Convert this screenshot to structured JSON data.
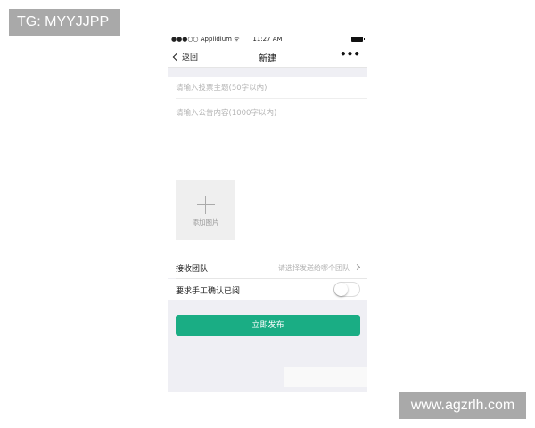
{
  "watermarks": {
    "top_left": "TG: MYYJJPP",
    "bottom_right": "www.agzrlh.com"
  },
  "status_bar": {
    "carrier": "●●●○○ Applidium ᯤ",
    "time": "11:27 AM",
    "battery_icon": "battery-icon"
  },
  "nav": {
    "back_label": "返回",
    "title": "新建",
    "more_label": "•••"
  },
  "form": {
    "title_placeholder": "请输入投票主题(50字以内)",
    "content_placeholder": "请输入公告内容(1000字以内)",
    "add_image_label": "添加图片"
  },
  "settings": {
    "team_label": "接收团队",
    "team_value": "请选择发送给哪个团队",
    "confirm_label": "要求手工确认已阅",
    "confirm_enabled": false
  },
  "actions": {
    "publish_label": "立即发布"
  },
  "colors": {
    "accent": "#1aad84",
    "background": "#efeff4"
  }
}
